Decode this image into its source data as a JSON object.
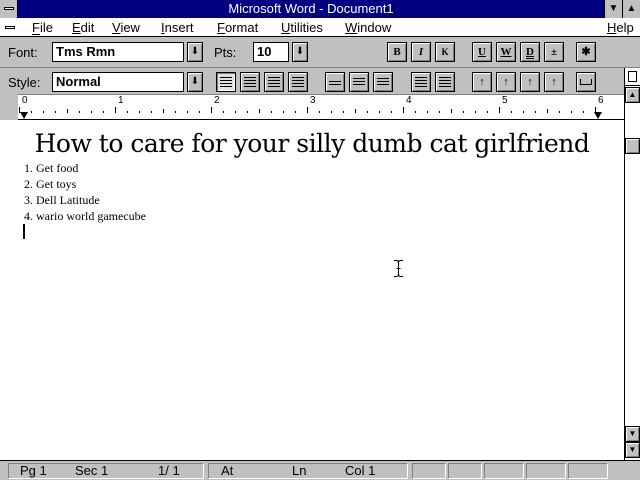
{
  "window": {
    "title": "Microsoft Word - Document1",
    "minimize_glyph": "▼",
    "maximize_glyph": "▲"
  },
  "menu": {
    "items": [
      {
        "label": "File"
      },
      {
        "label": "Edit"
      },
      {
        "label": "View"
      },
      {
        "label": "Insert"
      },
      {
        "label": "Format"
      },
      {
        "label": "Utilities"
      },
      {
        "label": "Window"
      }
    ],
    "help_label": "Help"
  },
  "ribbon": {
    "font_label": "Font:",
    "font_value": "Tms Rmn",
    "pts_label": "Pts:",
    "pts_value": "10",
    "dropdown_glyph": "⬇",
    "bold": "B",
    "italic": "I",
    "smallcaps": "K",
    "underline": "U",
    "word_underline": "W",
    "double_underline": "D",
    "superscript": "±",
    "show_all": "✱"
  },
  "ruler_bar": {
    "style_label": "Style:",
    "style_value": "Normal",
    "numbers": [
      "0",
      "1",
      "2",
      "3",
      "4",
      "5",
      "6"
    ]
  },
  "document": {
    "title": "How to care for your silly dumb cat girlfriend",
    "items": [
      "1. Get food",
      "2. Get toys",
      "3. Dell Latitude",
      "4. wario world gamecube"
    ]
  },
  "status": {
    "page": "Pg  1",
    "section": "Sec  1",
    "count": "1/ 1",
    "at": "At",
    "line": "Ln",
    "col": "Col  1"
  }
}
